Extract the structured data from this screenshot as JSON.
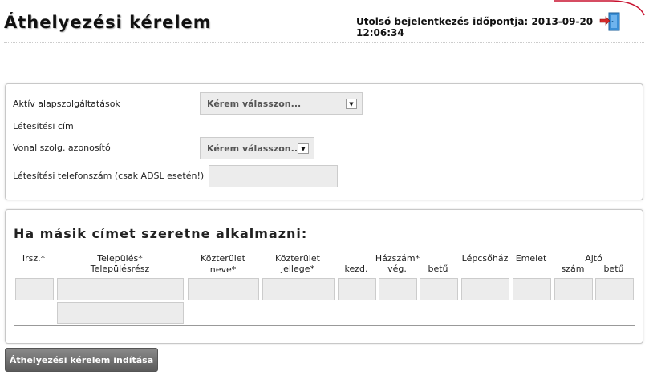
{
  "header": {
    "title": "Áthelyezési kérelem",
    "last_login": "Utolsó bejelentkezés időpontja: 2013-09-20 12:06:34",
    "logout_icon": "logout-door-icon",
    "accent_color": "#c8102e"
  },
  "service_panel": {
    "active_services_label": "Aktív alapszolgáltatások",
    "active_services_value": "Kérem válasszon...",
    "installation_address_label": "Létesítési cím",
    "line_id_label": "Vonal szolg. azonosító",
    "line_id_value": "Kérem válasszon...",
    "phone_label": "Létesítési telefonszám (csak ADSL esetén!)",
    "phone_value": ""
  },
  "address_panel": {
    "title": "Ha másik címet szeretne alkalmazni:",
    "columns": {
      "zip": "Irsz.*",
      "settlement": "Település*",
      "settlement_part": "Településrész",
      "street_name": "Közterület neve*",
      "street_type_1": "Közterület",
      "street_type_2": "jellege*",
      "house_number": "Házszám*",
      "house_start": "kezd.",
      "house_end": "vég.",
      "house_letter": "betű",
      "staircase": "Lépcsőház",
      "floor": "Emelet",
      "door": "Ajtó",
      "door_number": "szám",
      "door_letter": "betű"
    }
  },
  "actions": {
    "submit_label": "Áthelyezési kérelem indítása"
  }
}
